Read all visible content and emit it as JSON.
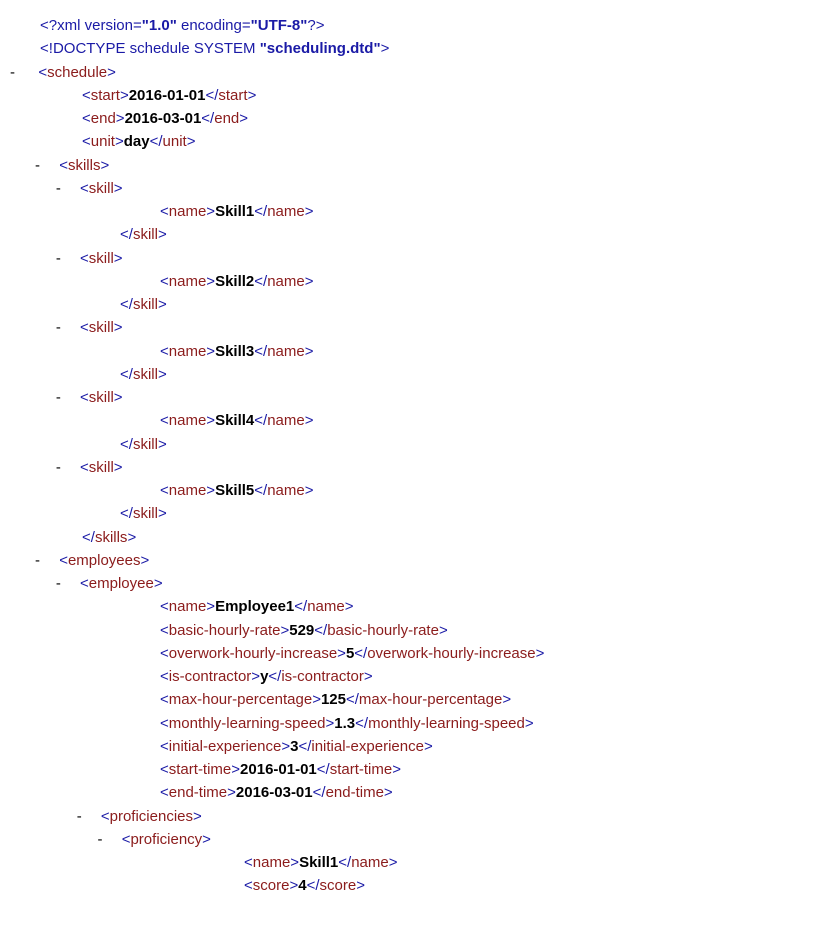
{
  "xmldecl": {
    "prefix": "<?",
    "name": "xml",
    "attrs": " version=",
    "v1": "\"1.0\"",
    "attrs2": " encoding=",
    "v2": "\"UTF-8\"",
    "suffix": "?>"
  },
  "doctype": {
    "prefix": "<!",
    "name": "DOCTYPE",
    "body": " schedule SYSTEM ",
    "file": "\"scheduling.dtd\"",
    "suffix": ">"
  },
  "tags": {
    "schedule": "schedule",
    "start": "start",
    "end": "end",
    "unit": "unit",
    "skills": "skills",
    "skill": "skill",
    "name": "name",
    "employees": "employees",
    "employee": "employee",
    "bhr": "basic-hourly-rate",
    "ohi": "overwork-hourly-increase",
    "isc": "is-contractor",
    "mhp": "max-hour-percentage",
    "mls": "monthly-learning-speed",
    "iex": "initial-experience",
    "stt": "start-time",
    "ent": "end-time",
    "profs": "proficiencies",
    "prof": "proficiency",
    "score": "score"
  },
  "values": {
    "start": "2016-01-01",
    "end": "2016-03-01",
    "unit": "day",
    "skill1": "Skill1",
    "skill2": "Skill2",
    "skill3": "Skill3",
    "skill4": "Skill4",
    "skill5": "Skill5",
    "emp1": "Employee1",
    "bhr": "529",
    "ohi": "5",
    "isc": "y",
    "mhp": "125",
    "mls": "1.3",
    "iex": "3",
    "stt": "2016-01-01",
    "ent": "2016-03-01",
    "pname": "Skill1",
    "pscore": "4"
  },
  "dash": "-"
}
